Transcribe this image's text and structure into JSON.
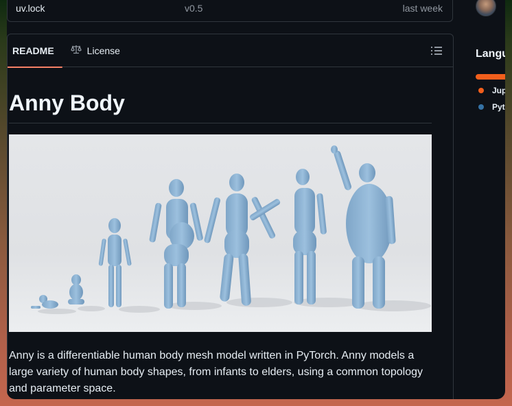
{
  "file_row": {
    "name": "uv.lock",
    "message": "v0.5",
    "date": "last week"
  },
  "tabs": [
    {
      "label": "README",
      "icon": "book-icon",
      "active": true
    },
    {
      "label": "License",
      "icon": "scale-icon",
      "active": false
    }
  ],
  "article": {
    "title": "Anny Body",
    "image_alt": "Human body meshes from infant to elder",
    "paragraph": "Anny is a differentiable human body mesh model written in PyTorch. Anny models a large variety of human body shapes, from infants to elders, using a common topology and parameter space."
  },
  "sidebar": {
    "languages_title": "Langu",
    "languages": [
      {
        "name": "Jup",
        "color": "#f25f1c"
      },
      {
        "name": "Pyt",
        "color": "#3572a5"
      }
    ]
  },
  "colors": {
    "accent": "#f78166",
    "figure": "#8fb4d4",
    "figure_shadow": "#6f97bb"
  }
}
